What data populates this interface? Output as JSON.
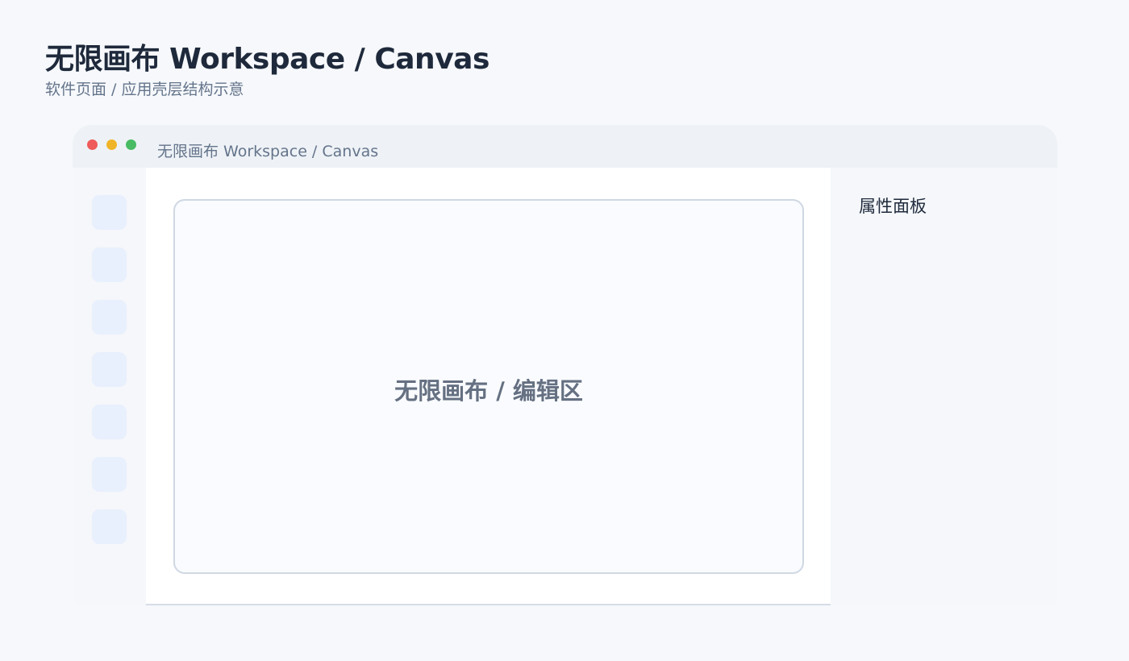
{
  "header": {
    "title": "无限画布 Workspace / Canvas",
    "subtitle": "软件页面 / 应用壳层结构示意"
  },
  "window": {
    "title": "无限画布 Workspace / Canvas",
    "controls": [
      "close",
      "minimize",
      "maximize"
    ],
    "control_colors": {
      "close": "#ef5a5a",
      "minimize": "#f0b429",
      "maximize": "#48bb63"
    }
  },
  "toolbar": {
    "button_count": 7,
    "button_color": "#e8effd"
  },
  "canvas": {
    "label": "无限画布 / 编辑区"
  },
  "panel": {
    "title": "属性面板"
  },
  "colors": {
    "page_background": "#f6f8fb",
    "title_text": "#1e293b",
    "muted_text": "#64748b",
    "canvas_border": "#cfd8e3"
  }
}
